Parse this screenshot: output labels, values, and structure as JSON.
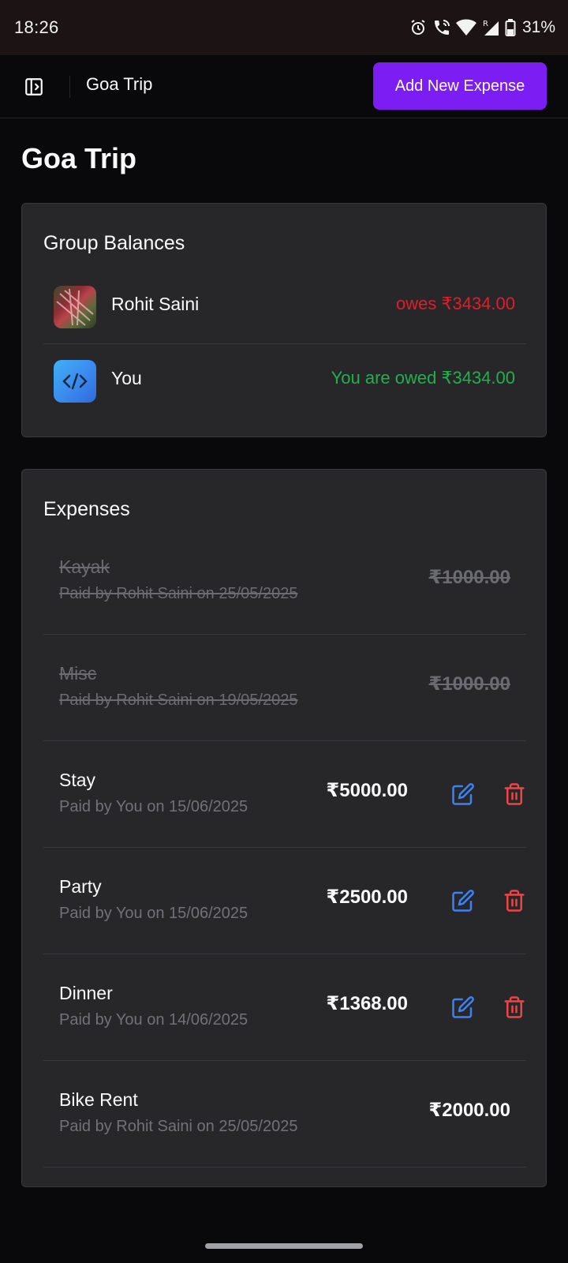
{
  "status_bar": {
    "time": "18:26",
    "battery": "31%",
    "icons": [
      "alarm-icon",
      "wifi-call-icon",
      "wifi-icon",
      "signal-icon",
      "battery-icon"
    ]
  },
  "nav": {
    "breadcrumb": "Goa Trip",
    "add_expense_label": "Add New Expense",
    "accent_color": "#7c1df3"
  },
  "page": {
    "title": "Goa Trip"
  },
  "balances": {
    "title": "Group Balances",
    "rows": [
      {
        "name": "Rohit Saini",
        "amount_text": "owes ₹3434.00",
        "status": "owes",
        "color": "#e11d2a"
      },
      {
        "name": "You",
        "amount_text": "You are owed ₹3434.00",
        "status": "owed",
        "color": "#22b04d"
      }
    ]
  },
  "expenses": {
    "title": "Expenses",
    "items": [
      {
        "name": "Kayak",
        "subtitle": "Paid by Rohit Saini on 25/05/2025",
        "amount": "₹1000.00",
        "settled": true
      },
      {
        "name": "Misc",
        "subtitle": "Paid by Rohit Saini on 19/05/2025",
        "amount": "₹1000.00",
        "settled": true
      },
      {
        "name": "Stay",
        "subtitle": "Paid by You on 15/06/2025",
        "amount": "₹5000.00",
        "settled": false,
        "editable": true
      },
      {
        "name": "Party",
        "subtitle": "Paid by You on 15/06/2025",
        "amount": "₹2500.00",
        "settled": false,
        "editable": true
      },
      {
        "name": "Dinner",
        "subtitle": "Paid by You on 14/06/2025",
        "amount": "₹1368.00",
        "settled": false,
        "editable": true
      },
      {
        "name": "Bike Rent",
        "subtitle": "Paid by Rohit Saini on 25/05/2025",
        "amount": "₹2000.00",
        "settled": false,
        "editable": false
      }
    ]
  }
}
